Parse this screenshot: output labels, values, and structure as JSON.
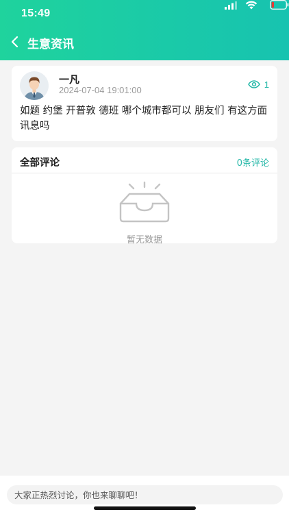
{
  "status_bar": {
    "time": "15:49"
  },
  "nav": {
    "title": "生意资讯"
  },
  "post": {
    "author": "一凡",
    "time": "2024-07-04 19:01:00",
    "views": "1",
    "content": "如题 约堡 开普敦 德班 哪个城市都可以 朋友们 有这方面讯息吗"
  },
  "comments": {
    "title": "全部评论",
    "count": "0条评论",
    "empty_text": "暂无数据"
  },
  "input": {
    "placeholder": "大家正热烈讨论，你也来聊聊吧！"
  },
  "colors": {
    "header_gradient_start": "#1fd39d",
    "header_gradient_end": "#17c3b0",
    "accent": "#26b8a8",
    "battery_low": "#e53935"
  }
}
